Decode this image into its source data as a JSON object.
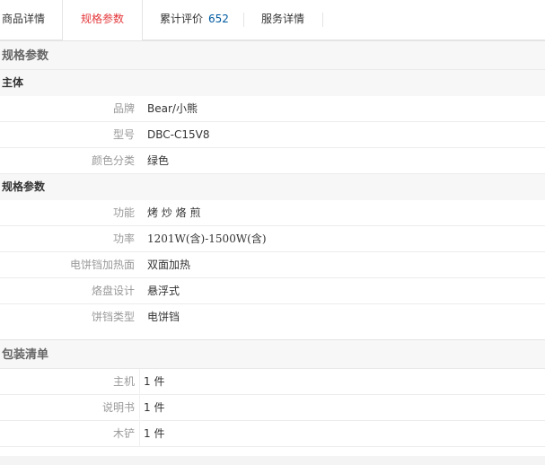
{
  "tabs": [
    {
      "label": "商品详情"
    },
    {
      "label": "规格参数"
    },
    {
      "label": "累计评价",
      "count": "652"
    },
    {
      "label": "服务详情"
    }
  ],
  "spec": {
    "title": "规格参数",
    "groups": [
      {
        "name": "主体",
        "rows": [
          {
            "key": "品牌",
            "value": "Bear/小熊"
          },
          {
            "key": "型号",
            "value": "DBC-C15V8"
          },
          {
            "key": "颜色分类",
            "value": "绿色"
          }
        ]
      },
      {
        "name": "规格参数",
        "rows": [
          {
            "key": "功能",
            "value": "烤 炒 烙 煎"
          },
          {
            "key": "功率",
            "value": "1201W(含)-1500W(含)"
          },
          {
            "key": "电饼铛加热面",
            "value": "双面加热"
          },
          {
            "key": "烙盘设计",
            "value": "悬浮式"
          },
          {
            "key": "饼铛类型",
            "value": "电饼铛"
          }
        ]
      }
    ]
  },
  "packing": {
    "title": "包装清单",
    "rows": [
      {
        "key": "主机",
        "value": "1 件"
      },
      {
        "key": "说明书",
        "value": "1 件"
      },
      {
        "key": "木铲",
        "value": "1 件"
      }
    ]
  },
  "colors": {
    "accent": "#e4393c",
    "link": "#005aa0",
    "header_bg": "#f7f7f7"
  }
}
